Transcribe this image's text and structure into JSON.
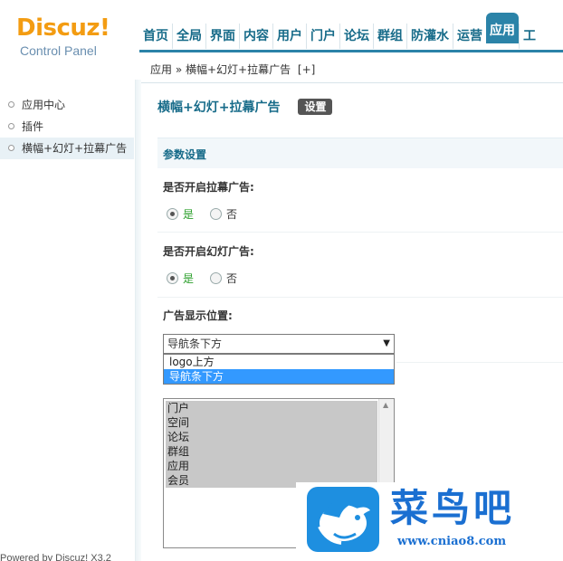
{
  "header": {
    "logo_main": "Discuz!",
    "logo_sub": "Control Panel",
    "nav": [
      "首页",
      "全局",
      "界面",
      "内容",
      "用户",
      "门户",
      "论坛",
      "群组",
      "防灌水",
      "运营",
      "应用",
      "工"
    ],
    "nav_active_index": 10
  },
  "breadcrumb": {
    "text": "应用 » 横幅+幻灯+拉幕广告",
    "add": "[+]"
  },
  "sidebar": {
    "items": [
      {
        "label": "应用中心",
        "active": false
      },
      {
        "label": "插件",
        "active": false
      },
      {
        "label": "横幅+幻灯+拉幕广告",
        "active": true
      }
    ],
    "powered": "Powered by Discuz! X3.2"
  },
  "main": {
    "title": "横幅+幻灯+拉幕广告",
    "settings_button": "设置",
    "section_title": "参数设置",
    "curtain_ad": {
      "label": "是否开启拉幕广告:",
      "yes": "是",
      "no": "否",
      "value": "yes"
    },
    "slide_ad": {
      "label": "是否开启幻灯广告:",
      "yes": "是",
      "no": "否",
      "value": "yes"
    },
    "position": {
      "label": "广告显示位置:",
      "selected": "导航条下方",
      "options": [
        "logo上方",
        "导航条下方"
      ]
    },
    "modules": [
      "门户",
      "空间",
      "论坛",
      "群组",
      "应用",
      "会员"
    ]
  },
  "watermark": {
    "title": "菜鸟吧",
    "url": "www.cniao8.com"
  },
  "colors": {
    "nav_active": "#2b83a8",
    "link": "#176b89",
    "logo": "#f39c12",
    "watermark": "#1a6fd1"
  }
}
